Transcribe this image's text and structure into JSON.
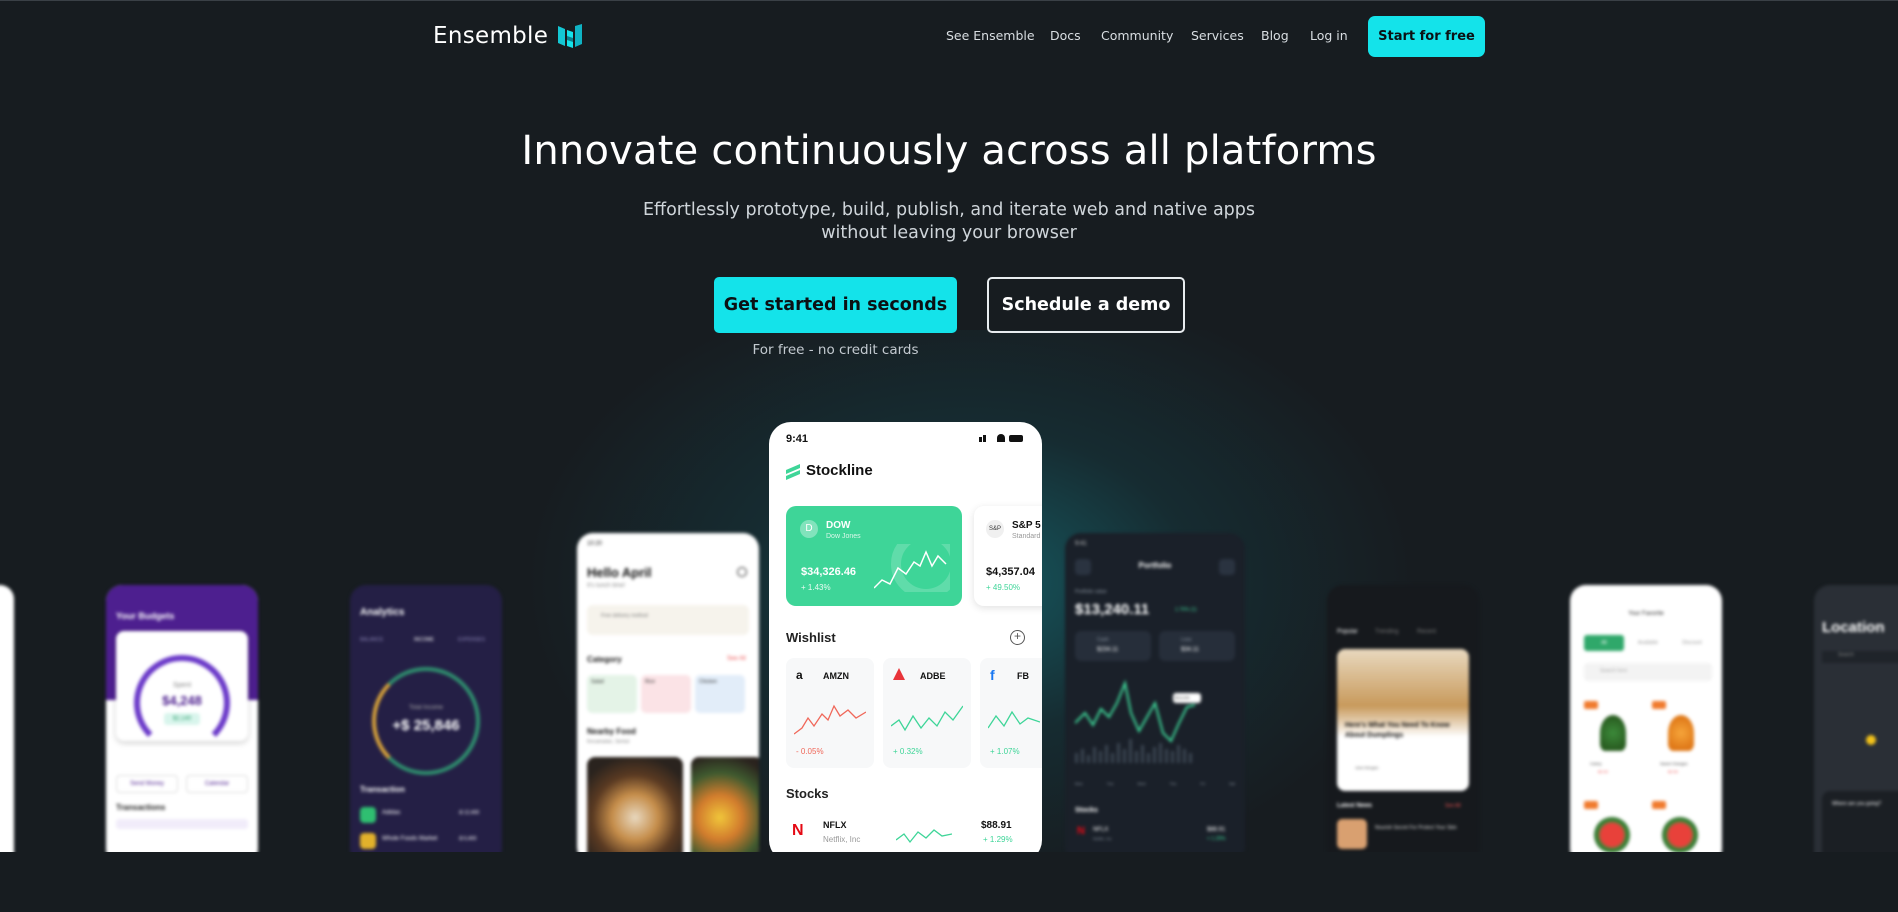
{
  "header": {
    "logo_text": "Ensemble",
    "nav": [
      "See Ensemble",
      "Docs",
      "Community",
      "Services",
      "Blog",
      "Log in"
    ],
    "cta": "Start for free"
  },
  "hero": {
    "title": "Innovate continuously across all platforms",
    "subtitle_line1": "Effortlessly prototype, build, publish, and iterate web and native apps",
    "subtitle_line2": "without leaving your browser",
    "primary_button": "Get started in seconds",
    "secondary_button": "Schedule a demo",
    "note": "For free - no credit cards"
  },
  "colors": {
    "accent": "#14e3ea",
    "background": "#171c20",
    "brand_green": "#3ed598"
  },
  "stockline": {
    "time": "9:41",
    "app_name": "Stockline",
    "cards": [
      {
        "ticker": "DOW",
        "name": "Dow Jones",
        "price": "$34,326.46",
        "change": "+ 1.43%"
      },
      {
        "ticker": "S&P 5",
        "name": "Standard",
        "price": "$4,357.04",
        "change": "+ 49.50%"
      }
    ],
    "wishlist_title": "Wishlist",
    "wishlist": [
      {
        "ticker": "AMZN",
        "change": "- 0.05%"
      },
      {
        "ticker": "ADBE",
        "change": "+ 0.32%"
      },
      {
        "ticker": "FB",
        "change": "+ 1.07%"
      }
    ],
    "stocks_title": "Stocks",
    "stocks": [
      {
        "ticker": "NFLX",
        "name": "Netflix, Inc",
        "price": "$88.91",
        "change": "+ 1.29%"
      }
    ]
  },
  "portfolio": {
    "title": "Portfolio",
    "label": "Portfolio value",
    "value": "$13,240.11",
    "change": "1.76% (1)",
    "pills": [
      {
        "label": "Cash",
        "value": "$234.11"
      },
      {
        "label": "Loss",
        "value": "$34.11"
      }
    ],
    "tooltip": "$13,240",
    "days": [
      "Mon",
      "Tue",
      "Wed",
      "Thu",
      "Fri",
      "Sat"
    ],
    "stocks_title": "Stocks",
    "stock": {
      "ticker": "NFLX",
      "name": "Netflix, Inc",
      "price": "$88.91",
      "change": "+ 1.29%"
    }
  },
  "food": {
    "time": "10:20",
    "greeting": "Hello April",
    "sub": "It's lunch time!",
    "promo": "Free delivery method",
    "category": "Category",
    "see_all": "See All",
    "chips": [
      "Salad",
      "Rice",
      "Chicken"
    ],
    "nearby": "Nearby Food",
    "nearby_sub": "Kecamatan, Sentul"
  },
  "budget": {
    "title": "Your Budgets",
    "amount": "$4,248",
    "sub": "Spent",
    "tag": "$2,140",
    "btn1": "Send Money",
    "btn2": "Calendar",
    "section": "Transactions"
  },
  "analytics": {
    "title": "Analytics",
    "tabs": [
      "BALANCE",
      "INCOME",
      "EXPENSES"
    ],
    "ring_label": "Total Income",
    "amount": "+$ 25,846",
    "section": "Transaction",
    "rows": [
      {
        "name": "Adidas",
        "amount": "-$ 12,400"
      },
      {
        "name": "Whole Foods Market",
        "amount": "-$ 6,400"
      }
    ]
  },
  "news": {
    "tabs": [
      "Popular",
      "Trending",
      "Recent"
    ],
    "headline": "Here's What You Need To Know About Dumplings",
    "author": "Jane Morgan",
    "section": "Latest News",
    "see_all": "See All",
    "item": "Nourish Secret For Protect Your Skin"
  },
  "groceries": {
    "title": "Your Favorite",
    "tabs": [
      "All",
      "Available",
      "Discount"
    ],
    "search": "Search here",
    "items": [
      {
        "name": "Celery",
        "price": "$2.00"
      },
      {
        "name": "Sweet Oranges",
        "price": "$2.50"
      }
    ]
  },
  "location": {
    "title": "Location",
    "search": "Search",
    "question": "Where are you going?"
  }
}
